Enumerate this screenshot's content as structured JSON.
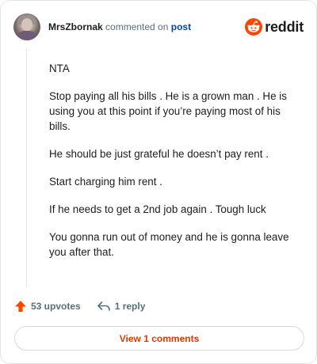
{
  "comment": {
    "username": "MrsZbornak",
    "action_text": "commented on",
    "target_link": "post",
    "paragraphs": [
      "NTA",
      "Stop paying all his bills . He is a grown man . He is using you at this point if you’re paying most of his bills.",
      "He should be just grateful he doesn’t pay rent .",
      "Start charging him rent .",
      "If he needs to get a 2nd job again . Tough luck",
      "You gonna run out of money and he is gonna leave you after that."
    ]
  },
  "brand": {
    "wordmark": "reddit",
    "accent": "#ff4500"
  },
  "footer": {
    "upvotes_label": "53 upvotes",
    "reply_label": "1 reply",
    "view_comments_label": "View 1 comments"
  },
  "icons": {
    "upvote": "upvote-arrow-icon",
    "reply": "reply-arrow-icon",
    "logo": "reddit-snoo-icon"
  }
}
